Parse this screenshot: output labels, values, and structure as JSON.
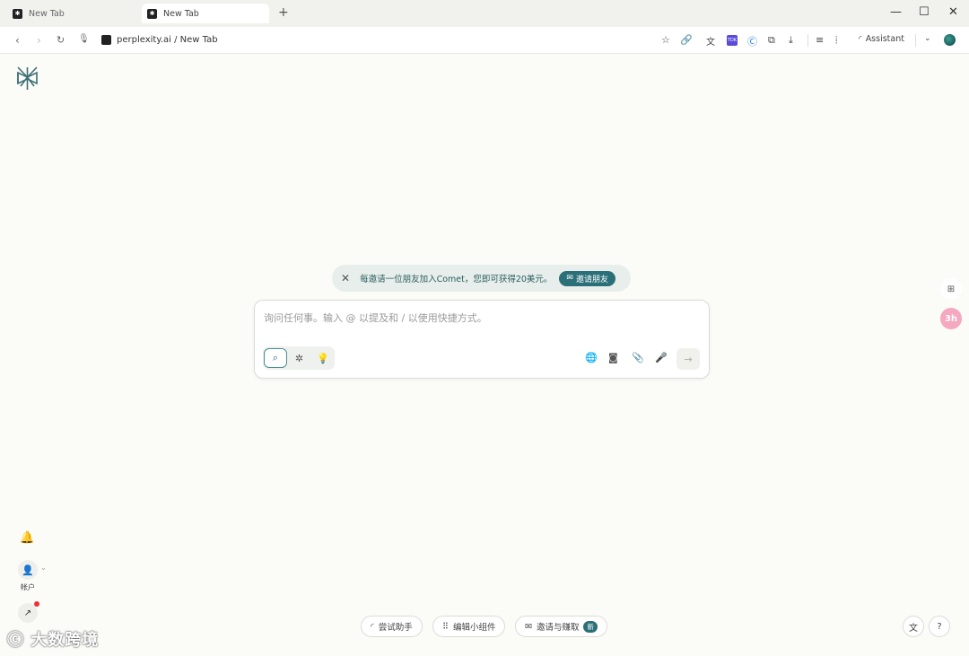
{
  "tabs": [
    {
      "label": "New Tab"
    },
    {
      "label": "New Tab"
    }
  ],
  "address": {
    "text": "perplexity.ai / New Tab"
  },
  "toolbar": {
    "assistant_label": "Assistant",
    "ext_badge": "TDK"
  },
  "banner": {
    "text": "每邀请一位朋友加入Comet，您即可获得20美元。",
    "button_label": "邀请朋友"
  },
  "search": {
    "placeholder": "询问任何事。输入 @ 以提及和 / 以使用快捷方式。"
  },
  "sidebar": {
    "account_label": "帐户",
    "right_widget_2": "3h"
  },
  "footer": {
    "try_assistant": "尝试助手",
    "edit_widgets": "编辑小组件",
    "invite_earn": "邀请与赚取",
    "new_badge": "新"
  },
  "watermark": "大数跨境",
  "colors": {
    "accent": "#2b6f78",
    "background": "#fbfbf8",
    "banner_bg": "#e7eeeb"
  }
}
